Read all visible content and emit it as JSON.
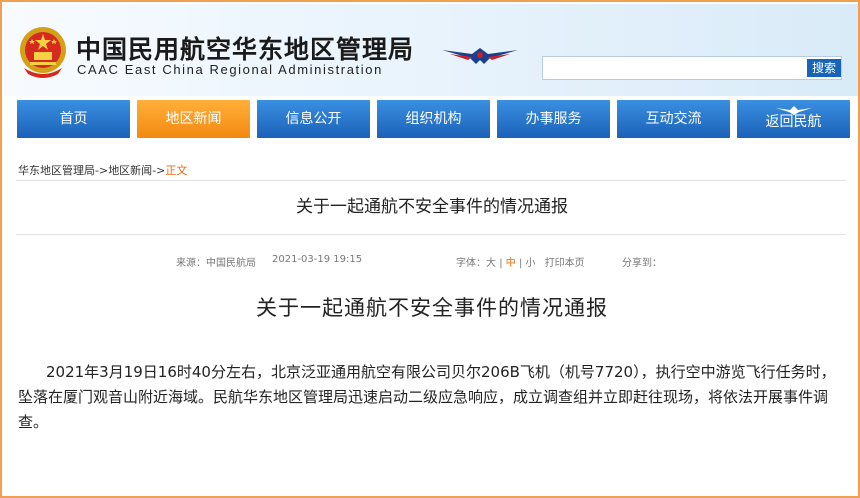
{
  "header": {
    "title_cn": "中国民用航空华东地区管理局",
    "title_en": "CAAC East China Regional Administration",
    "emblem_icon": "national-emblem-icon",
    "logo_icon": "caac-wings-icon"
  },
  "search": {
    "value": "",
    "placeholder": "",
    "button_label": "搜索"
  },
  "nav": {
    "items": [
      {
        "label": "首页",
        "active": false
      },
      {
        "label": "地区新闻",
        "active": true
      },
      {
        "label": "信息公开",
        "active": false
      },
      {
        "label": "组织机构",
        "active": false
      },
      {
        "label": "办事服务",
        "active": false
      },
      {
        "label": "互动交流",
        "active": false
      },
      {
        "label": "返回民航",
        "active": false
      }
    ]
  },
  "breadcrumb": {
    "items": [
      "华东地区管理局",
      "地区新闻",
      "正文"
    ],
    "separator": "->"
  },
  "page_title": "关于一起通航不安全事件的情况通报",
  "meta": {
    "source_label": "来源：",
    "source": "中国民航局",
    "datetime": "2021-03-19 19:15",
    "font_label": "字体：",
    "font_large": "大",
    "font_medium": "中",
    "font_small": "小",
    "print_label": "打印本页",
    "share_label": "分享到：",
    "divider": "|"
  },
  "article": {
    "title": "关于一起通航不安全事件的情况通报",
    "body": "2021年3月19日16时40分左右，北京泛亚通用航空有限公司贝尔206B飞机（机号7720），执行空中游览飞行任务时，坠落在厦门观音山附近海域。民航华东地区管理局迅速启动二级应急响应，成立调查组并立即赶往现场，将依法开展事件调查。"
  },
  "colors": {
    "nav_blue": "#1a62b8",
    "nav_active_orange": "#f28a10",
    "frame_border": "#f0a050",
    "breadcrumb_current": "#e86a10",
    "search_button": "#1665b8"
  }
}
